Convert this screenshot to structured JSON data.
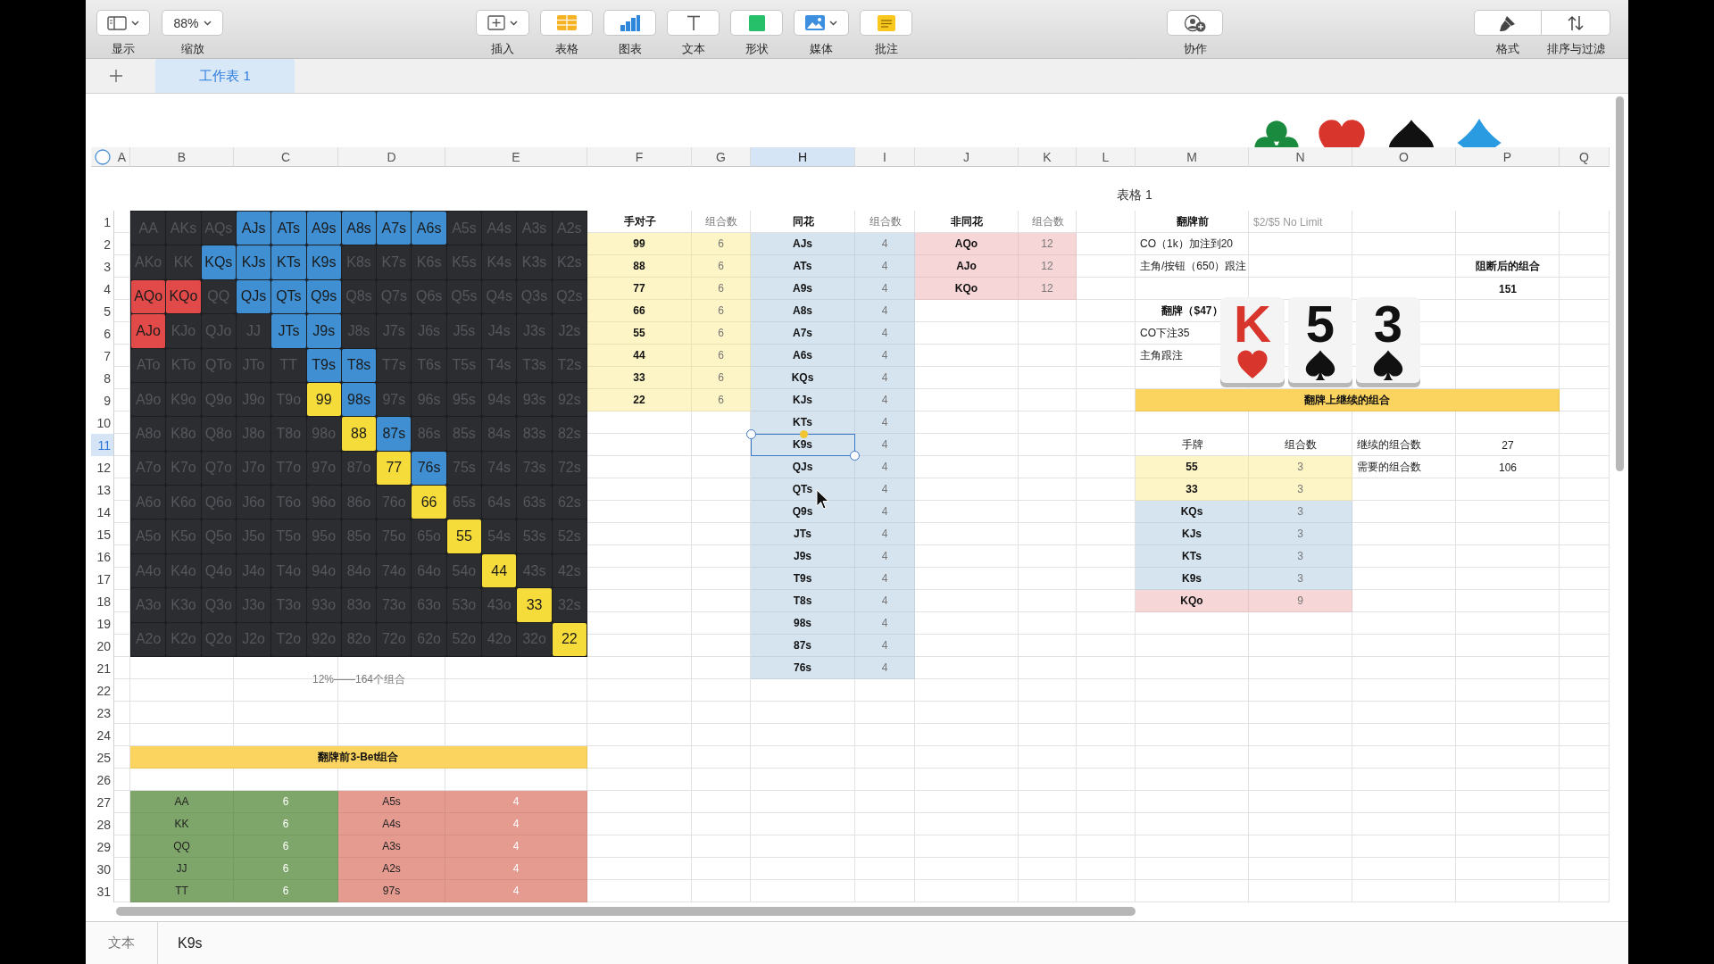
{
  "toolbar": {
    "left": [
      {
        "kind": "view",
        "label": "显示",
        "dropdown": true
      },
      {
        "kind": "zoom",
        "label": "缩放",
        "value": "88%",
        "dropdown": true
      }
    ],
    "center": [
      {
        "kind": "insert",
        "label": "插入",
        "dropdown": true
      },
      {
        "kind": "table",
        "label": "表格",
        "dropdown": false
      },
      {
        "kind": "chart",
        "label": "图表",
        "dropdown": false
      },
      {
        "kind": "text",
        "label": "文本",
        "dropdown": false
      },
      {
        "kind": "shape",
        "label": "形状",
        "dropdown": false
      },
      {
        "kind": "media",
        "label": "媒体",
        "dropdown": true
      },
      {
        "kind": "comment",
        "label": "批注",
        "dropdown": false
      }
    ],
    "share": [
      {
        "kind": "collaborate",
        "label": "协作",
        "dropdown": false
      }
    ],
    "right": [
      {
        "kind": "format",
        "label": "格式",
        "dropdown": false
      },
      {
        "kind": "sort",
        "label": "排序与过滤",
        "dropdown": false
      }
    ]
  },
  "sheet_tabs": [
    {
      "label": "工作表 1",
      "selected": true
    }
  ],
  "columns": [
    {
      "label": "A",
      "selected": false
    },
    {
      "label": "B",
      "selected": false
    },
    {
      "label": "C",
      "selected": false
    },
    {
      "label": "D",
      "selected": false
    },
    {
      "label": "E",
      "selected": false
    },
    {
      "label": "F",
      "selected": false
    },
    {
      "label": "G",
      "selected": false
    },
    {
      "label": "H",
      "selected": true
    },
    {
      "label": "I",
      "selected": false
    },
    {
      "label": "J",
      "selected": false
    },
    {
      "label": "K",
      "selected": false
    },
    {
      "label": "L",
      "selected": false
    },
    {
      "label": "M",
      "selected": false
    },
    {
      "label": "N",
      "selected": false
    },
    {
      "label": "O",
      "selected": false
    },
    {
      "label": "P",
      "selected": false
    },
    {
      "label": "Q",
      "selected": false
    }
  ],
  "rows": [
    {
      "label": "1",
      "selected": false
    },
    {
      "label": "2",
      "selected": false
    },
    {
      "label": "3",
      "selected": false
    },
    {
      "label": "4",
      "selected": false
    },
    {
      "label": "5",
      "selected": false
    },
    {
      "label": "6",
      "selected": false
    },
    {
      "label": "7",
      "selected": false
    },
    {
      "label": "8",
      "selected": false
    },
    {
      "label": "9",
      "selected": false
    },
    {
      "label": "10",
      "selected": false
    },
    {
      "label": "11",
      "selected": true
    },
    {
      "label": "12",
      "selected": false
    },
    {
      "label": "13",
      "selected": false
    },
    {
      "label": "14",
      "selected": false
    },
    {
      "label": "15",
      "selected": false
    },
    {
      "label": "16",
      "selected": false
    },
    {
      "label": "17",
      "selected": false
    },
    {
      "label": "18",
      "selected": false
    },
    {
      "label": "19",
      "selected": false
    },
    {
      "label": "20",
      "selected": false
    },
    {
      "label": "21",
      "selected": false
    },
    {
      "label": "22",
      "selected": false
    },
    {
      "label": "23",
      "selected": false
    },
    {
      "label": "24",
      "selected": false
    },
    {
      "label": "25",
      "selected": false
    },
    {
      "label": "26",
      "selected": false
    },
    {
      "label": "27",
      "selected": false
    },
    {
      "label": "28",
      "selected": false
    },
    {
      "label": "29",
      "selected": false
    },
    {
      "label": "30",
      "selected": false
    },
    {
      "label": "31",
      "selected": false
    }
  ],
  "table_title": "表格 1",
  "hand_chart": {
    "rows": [
      [
        {
          "hand": "AA",
          "color": "#2c2d31"
        },
        {
          "hand": "AKs",
          "color": "#2c2d31"
        },
        {
          "hand": "AQs",
          "color": "#2c2d31"
        },
        {
          "hand": "AJs",
          "color": "#3f8fd2"
        },
        {
          "hand": "ATs",
          "color": "#3f8fd2"
        },
        {
          "hand": "A9s",
          "color": "#3f8fd2"
        },
        {
          "hand": "A8s",
          "color": "#3f8fd2"
        },
        {
          "hand": "A7s",
          "color": "#3f8fd2"
        },
        {
          "hand": "A6s",
          "color": "#3f8fd2"
        },
        {
          "hand": "A5s",
          "color": "#2c2d31"
        },
        {
          "hand": "A4s",
          "color": "#2c2d31"
        },
        {
          "hand": "A3s",
          "color": "#2c2d31"
        },
        {
          "hand": "A2s",
          "color": "#2c2d31"
        }
      ],
      [
        {
          "hand": "AKo",
          "color": "#2c2d31"
        },
        {
          "hand": "KK",
          "color": "#2c2d31"
        },
        {
          "hand": "KQs",
          "color": "#3f8fd2"
        },
        {
          "hand": "KJs",
          "color": "#3f8fd2"
        },
        {
          "hand": "KTs",
          "color": "#3f8fd2"
        },
        {
          "hand": "K9s",
          "color": "#3f8fd2"
        },
        {
          "hand": "K8s",
          "color": "#2c2d31"
        },
        {
          "hand": "K7s",
          "color": "#2c2d31"
        },
        {
          "hand": "K6s",
          "color": "#2c2d31"
        },
        {
          "hand": "K5s",
          "color": "#2c2d31"
        },
        {
          "hand": "K4s",
          "color": "#2c2d31"
        },
        {
          "hand": "K3s",
          "color": "#2c2d31"
        },
        {
          "hand": "K2s",
          "color": "#2c2d31"
        }
      ],
      [
        {
          "hand": "AQo",
          "color": "#e24a4a"
        },
        {
          "hand": "KQo",
          "color": "#e24a4a"
        },
        {
          "hand": "QQ",
          "color": "#2c2d31"
        },
        {
          "hand": "QJs",
          "color": "#3f8fd2"
        },
        {
          "hand": "QTs",
          "color": "#3f8fd2"
        },
        {
          "hand": "Q9s",
          "color": "#3f8fd2"
        },
        {
          "hand": "Q8s",
          "color": "#2c2d31"
        },
        {
          "hand": "Q7s",
          "color": "#2c2d31"
        },
        {
          "hand": "Q6s",
          "color": "#2c2d31"
        },
        {
          "hand": "Q5s",
          "color": "#2c2d31"
        },
        {
          "hand": "Q4s",
          "color": "#2c2d31"
        },
        {
          "hand": "Q3s",
          "color": "#2c2d31"
        },
        {
          "hand": "Q2s",
          "color": "#2c2d31"
        }
      ],
      [
        {
          "hand": "AJo",
          "color": "#e24a4a"
        },
        {
          "hand": "KJo",
          "color": "#2c2d31"
        },
        {
          "hand": "QJo",
          "color": "#2c2d31"
        },
        {
          "hand": "JJ",
          "color": "#2c2d31"
        },
        {
          "hand": "JTs",
          "color": "#3f8fd2"
        },
        {
          "hand": "J9s",
          "color": "#3f8fd2"
        },
        {
          "hand": "J8s",
          "color": "#2c2d31"
        },
        {
          "hand": "J7s",
          "color": "#2c2d31"
        },
        {
          "hand": "J6s",
          "color": "#2c2d31"
        },
        {
          "hand": "J5s",
          "color": "#2c2d31"
        },
        {
          "hand": "J4s",
          "color": "#2c2d31"
        },
        {
          "hand": "J3s",
          "color": "#2c2d31"
        },
        {
          "hand": "J2s",
          "color": "#2c2d31"
        }
      ],
      [
        {
          "hand": "ATo",
          "color": "#2c2d31"
        },
        {
          "hand": "KTo",
          "color": "#2c2d31"
        },
        {
          "hand": "QTo",
          "color": "#2c2d31"
        },
        {
          "hand": "JTo",
          "color": "#2c2d31"
        },
        {
          "hand": "TT",
          "color": "#2c2d31"
        },
        {
          "hand": "T9s",
          "color": "#3f8fd2"
        },
        {
          "hand": "T8s",
          "color": "#3f8fd2"
        },
        {
          "hand": "T7s",
          "color": "#2c2d31"
        },
        {
          "hand": "T6s",
          "color": "#2c2d31"
        },
        {
          "hand": "T5s",
          "color": "#2c2d31"
        },
        {
          "hand": "T4s",
          "color": "#2c2d31"
        },
        {
          "hand": "T3s",
          "color": "#2c2d31"
        },
        {
          "hand": "T2s",
          "color": "#2c2d31"
        }
      ],
      [
        {
          "hand": "A9o",
          "color": "#2c2d31"
        },
        {
          "hand": "K9o",
          "color": "#2c2d31"
        },
        {
          "hand": "Q9o",
          "color": "#2c2d31"
        },
        {
          "hand": "J9o",
          "color": "#2c2d31"
        },
        {
          "hand": "T9o",
          "color": "#2c2d31"
        },
        {
          "hand": "99",
          "color": "#f6dc3a"
        },
        {
          "hand": "98s",
          "color": "#3f8fd2"
        },
        {
          "hand": "97s",
          "color": "#2c2d31"
        },
        {
          "hand": "96s",
          "color": "#2c2d31"
        },
        {
          "hand": "95s",
          "color": "#2c2d31"
        },
        {
          "hand": "94s",
          "color": "#2c2d31"
        },
        {
          "hand": "93s",
          "color": "#2c2d31"
        },
        {
          "hand": "92s",
          "color": "#2c2d31"
        }
      ],
      [
        {
          "hand": "A8o",
          "color": "#2c2d31"
        },
        {
          "hand": "K8o",
          "color": "#2c2d31"
        },
        {
          "hand": "Q8o",
          "color": "#2c2d31"
        },
        {
          "hand": "J8o",
          "color": "#2c2d31"
        },
        {
          "hand": "T8o",
          "color": "#2c2d31"
        },
        {
          "hand": "98o",
          "color": "#2c2d31"
        },
        {
          "hand": "88",
          "color": "#f6dc3a"
        },
        {
          "hand": "87s",
          "color": "#3f8fd2"
        },
        {
          "hand": "86s",
          "color": "#2c2d31"
        },
        {
          "hand": "85s",
          "color": "#2c2d31"
        },
        {
          "hand": "84s",
          "color": "#2c2d31"
        },
        {
          "hand": "83s",
          "color": "#2c2d31"
        },
        {
          "hand": "82s",
          "color": "#2c2d31"
        }
      ],
      [
        {
          "hand": "A7o",
          "color": "#2c2d31"
        },
        {
          "hand": "K7o",
          "color": "#2c2d31"
        },
        {
          "hand": "Q7o",
          "color": "#2c2d31"
        },
        {
          "hand": "J7o",
          "color": "#2c2d31"
        },
        {
          "hand": "T7o",
          "color": "#2c2d31"
        },
        {
          "hand": "97o",
          "color": "#2c2d31"
        },
        {
          "hand": "87o",
          "color": "#2c2d31"
        },
        {
          "hand": "77",
          "color": "#f6dc3a"
        },
        {
          "hand": "76s",
          "color": "#3f8fd2"
        },
        {
          "hand": "75s",
          "color": "#2c2d31"
        },
        {
          "hand": "74s",
          "color": "#2c2d31"
        },
        {
          "hand": "73s",
          "color": "#2c2d31"
        },
        {
          "hand": "72s",
          "color": "#2c2d31"
        }
      ],
      [
        {
          "hand": "A6o",
          "color": "#2c2d31"
        },
        {
          "hand": "K6o",
          "color": "#2c2d31"
        },
        {
          "hand": "Q6o",
          "color": "#2c2d31"
        },
        {
          "hand": "J6o",
          "color": "#2c2d31"
        },
        {
          "hand": "T6o",
          "color": "#2c2d31"
        },
        {
          "hand": "96o",
          "color": "#2c2d31"
        },
        {
          "hand": "86o",
          "color": "#2c2d31"
        },
        {
          "hand": "76o",
          "color": "#2c2d31"
        },
        {
          "hand": "66",
          "color": "#f6dc3a"
        },
        {
          "hand": "65s",
          "color": "#2c2d31"
        },
        {
          "hand": "64s",
          "color": "#2c2d31"
        },
        {
          "hand": "63s",
          "color": "#2c2d31"
        },
        {
          "hand": "62s",
          "color": "#2c2d31"
        }
      ],
      [
        {
          "hand": "A5o",
          "color": "#2c2d31"
        },
        {
          "hand": "K5o",
          "color": "#2c2d31"
        },
        {
          "hand": "Q5o",
          "color": "#2c2d31"
        },
        {
          "hand": "J5o",
          "color": "#2c2d31"
        },
        {
          "hand": "T5o",
          "color": "#2c2d31"
        },
        {
          "hand": "95o",
          "color": "#2c2d31"
        },
        {
          "hand": "85o",
          "color": "#2c2d31"
        },
        {
          "hand": "75o",
          "color": "#2c2d31"
        },
        {
          "hand": "65o",
          "color": "#2c2d31"
        },
        {
          "hand": "55",
          "color": "#f6dc3a"
        },
        {
          "hand": "54s",
          "color": "#2c2d31"
        },
        {
          "hand": "53s",
          "color": "#2c2d31"
        },
        {
          "hand": "52s",
          "color": "#2c2d31"
        }
      ],
      [
        {
          "hand": "A4o",
          "color": "#2c2d31"
        },
        {
          "hand": "K4o",
          "color": "#2c2d31"
        },
        {
          "hand": "Q4o",
          "color": "#2c2d31"
        },
        {
          "hand": "J4o",
          "color": "#2c2d31"
        },
        {
          "hand": "T4o",
          "color": "#2c2d31"
        },
        {
          "hand": "94o",
          "color": "#2c2d31"
        },
        {
          "hand": "84o",
          "color": "#2c2d31"
        },
        {
          "hand": "74o",
          "color": "#2c2d31"
        },
        {
          "hand": "64o",
          "color": "#2c2d31"
        },
        {
          "hand": "54o",
          "color": "#2c2d31"
        },
        {
          "hand": "44",
          "color": "#f6dc3a"
        },
        {
          "hand": "43s",
          "color": "#2c2d31"
        },
        {
          "hand": "42s",
          "color": "#2c2d31"
        }
      ],
      [
        {
          "hand": "A3o",
          "color": "#2c2d31"
        },
        {
          "hand": "K3o",
          "color": "#2c2d31"
        },
        {
          "hand": "Q3o",
          "color": "#2c2d31"
        },
        {
          "hand": "J3o",
          "color": "#2c2d31"
        },
        {
          "hand": "T3o",
          "color": "#2c2d31"
        },
        {
          "hand": "93o",
          "color": "#2c2d31"
        },
        {
          "hand": "83o",
          "color": "#2c2d31"
        },
        {
          "hand": "73o",
          "color": "#2c2d31"
        },
        {
          "hand": "63o",
          "color": "#2c2d31"
        },
        {
          "hand": "53o",
          "color": "#2c2d31"
        },
        {
          "hand": "43o",
          "color": "#2c2d31"
        },
        {
          "hand": "33",
          "color": "#f6dc3a"
        },
        {
          "hand": "32s",
          "color": "#2c2d31"
        }
      ],
      [
        {
          "hand": "A2o",
          "color": "#2c2d31"
        },
        {
          "hand": "K2o",
          "color": "#2c2d31"
        },
        {
          "hand": "Q2o",
          "color": "#2c2d31"
        },
        {
          "hand": "J2o",
          "color": "#2c2d31"
        },
        {
          "hand": "T2o",
          "color": "#2c2d31"
        },
        {
          "hand": "92o",
          "color": "#2c2d31"
        },
        {
          "hand": "82o",
          "color": "#2c2d31"
        },
        {
          "hand": "72o",
          "color": "#2c2d31"
        },
        {
          "hand": "62o",
          "color": "#2c2d31"
        },
        {
          "hand": "52o",
          "color": "#2c2d31"
        },
        {
          "hand": "42o",
          "color": "#2c2d31"
        },
        {
          "hand": "32o",
          "color": "#2c2d31"
        },
        {
          "hand": "22",
          "color": "#f6dc3a"
        }
      ]
    ]
  },
  "range_summary": "12%——164个组合",
  "pairs_table": {
    "header": [
      "手对子",
      "组合数"
    ],
    "rows": [
      {
        "hand": "99",
        "count": "6",
        "color": "#fdf5c6"
      },
      {
        "hand": "88",
        "count": "6",
        "color": "#fdf5c6"
      },
      {
        "hand": "77",
        "count": "6",
        "color": "#fdf5c6"
      },
      {
        "hand": "66",
        "count": "6",
        "color": "#fdf5c6"
      },
      {
        "hand": "55",
        "count": "6",
        "color": "#fdf5c6"
      },
      {
        "hand": "44",
        "count": "6",
        "color": "#fdf5c6"
      },
      {
        "hand": "33",
        "count": "6",
        "color": "#fdf5c6"
      },
      {
        "hand": "22",
        "count": "6",
        "color": "#fdf5c6"
      }
    ]
  },
  "suited_table": {
    "header": [
      "同花",
      "组合数"
    ],
    "rows": [
      {
        "hand": "AJs",
        "count": "4",
        "color": "#d6e4f0"
      },
      {
        "hand": "ATs",
        "count": "4",
        "color": "#d6e4f0"
      },
      {
        "hand": "A9s",
        "count": "4",
        "color": "#d6e4f0"
      },
      {
        "hand": "A8s",
        "count": "4",
        "color": "#d6e4f0"
      },
      {
        "hand": "A7s",
        "count": "4",
        "color": "#d6e4f0"
      },
      {
        "hand": "A6s",
        "count": "4",
        "color": "#d6e4f0"
      },
      {
        "hand": "KQs",
        "count": "4",
        "color": "#d6e4f0"
      },
      {
        "hand": "KJs",
        "count": "4",
        "color": "#d6e4f0"
      },
      {
        "hand": "KTs",
        "count": "4",
        "color": "#d6e4f0"
      },
      {
        "hand": "K9s",
        "count": "4",
        "color": "#d6e4f0"
      },
      {
        "hand": "QJs",
        "count": "4",
        "color": "#d6e4f0"
      },
      {
        "hand": "QTs",
        "count": "4",
        "color": "#d6e4f0"
      },
      {
        "hand": "Q9s",
        "count": "4",
        "color": "#d6e4f0"
      },
      {
        "hand": "JTs",
        "count": "4",
        "color": "#d6e4f0"
      },
      {
        "hand": "J9s",
        "count": "4",
        "color": "#d6e4f0"
      },
      {
        "hand": "T9s",
        "count": "4",
        "color": "#d6e4f0"
      },
      {
        "hand": "T8s",
        "count": "4",
        "color": "#d6e4f0"
      },
      {
        "hand": "98s",
        "count": "4",
        "color": "#d6e4f0"
      },
      {
        "hand": "87s",
        "count": "4",
        "color": "#d6e4f0"
      },
      {
        "hand": "76s",
        "count": "4",
        "color": "#d6e4f0"
      }
    ]
  },
  "offsuit_table": {
    "header": [
      "非同花",
      "组合数"
    ],
    "rows": [
      {
        "hand": "AQo",
        "count": "12",
        "color": "#f7d6d8"
      },
      {
        "hand": "AJo",
        "count": "12",
        "color": "#f7d6d8"
      },
      {
        "hand": "KQo",
        "count": "12",
        "color": "#f7d6d8"
      }
    ]
  },
  "hand_info": {
    "title": "翻牌前",
    "stakes": "$2/$5 No Limit",
    "preflop_actions": [
      "CO（1k）加注到20",
      "主角/按钮（650）跟注"
    ],
    "flop": "翻牌（$47）",
    "flop_actions": [
      "CO下注35",
      "主角跟注"
    ]
  },
  "blocker": {
    "label": "阻断后的组合",
    "value": "151"
  },
  "cards": [
    {
      "rank": "K",
      "kind": "heart"
    },
    {
      "rank": "5",
      "kind": "spade"
    },
    {
      "rank": "3",
      "kind": "spade"
    }
  ],
  "continue_table": {
    "title": "翻牌上继续的组合",
    "header": [
      "手牌",
      "组合数"
    ],
    "rows": [
      {
        "hand": "55",
        "count": "3",
        "color": "#fdf5c6"
      },
      {
        "hand": "33",
        "count": "3",
        "color": "#fdf5c6"
      },
      {
        "hand": "KQs",
        "count": "3",
        "color": "#d6e4f0"
      },
      {
        "hand": "KJs",
        "count": "3",
        "color": "#d6e4f0"
      },
      {
        "hand": "KTs",
        "count": "3",
        "color": "#d6e4f0"
      },
      {
        "hand": "K9s",
        "count": "3",
        "color": "#d6e4f0"
      },
      {
        "hand": "KQo",
        "count": "9",
        "color": "#f7d6d8"
      }
    ],
    "stats": [
      {
        "label": "继续的组合数",
        "value": "27"
      },
      {
        "label": "需要的组合数",
        "value": "106"
      }
    ]
  },
  "threebet_table": {
    "title": "翻牌前3-Bet组合",
    "rows": [
      [
        {
          "hand": "AA",
          "count": "6",
          "color": "#7fa66a"
        },
        {
          "hand": "A5s",
          "count": "4",
          "color": "#e69b91"
        }
      ],
      [
        {
          "hand": "KK",
          "count": "6",
          "color": "#7fa66a"
        },
        {
          "hand": "A4s",
          "count": "4",
          "color": "#e69b91"
        }
      ],
      [
        {
          "hand": "QQ",
          "count": "6",
          "color": "#7fa66a"
        },
        {
          "hand": "A3s",
          "count": "4",
          "color": "#e69b91"
        }
      ],
      [
        {
          "hand": "JJ",
          "count": "6",
          "color": "#7fa66a"
        },
        {
          "hand": "A2s",
          "count": "4",
          "color": "#e69b91"
        }
      ],
      [
        {
          "hand": "TT",
          "count": "6",
          "color": "#7fa66a"
        },
        {
          "hand": "97s",
          "count": "4",
          "color": "#e69b91"
        }
      ]
    ]
  },
  "format_bar": {
    "label": "文本",
    "value": "K9s"
  }
}
